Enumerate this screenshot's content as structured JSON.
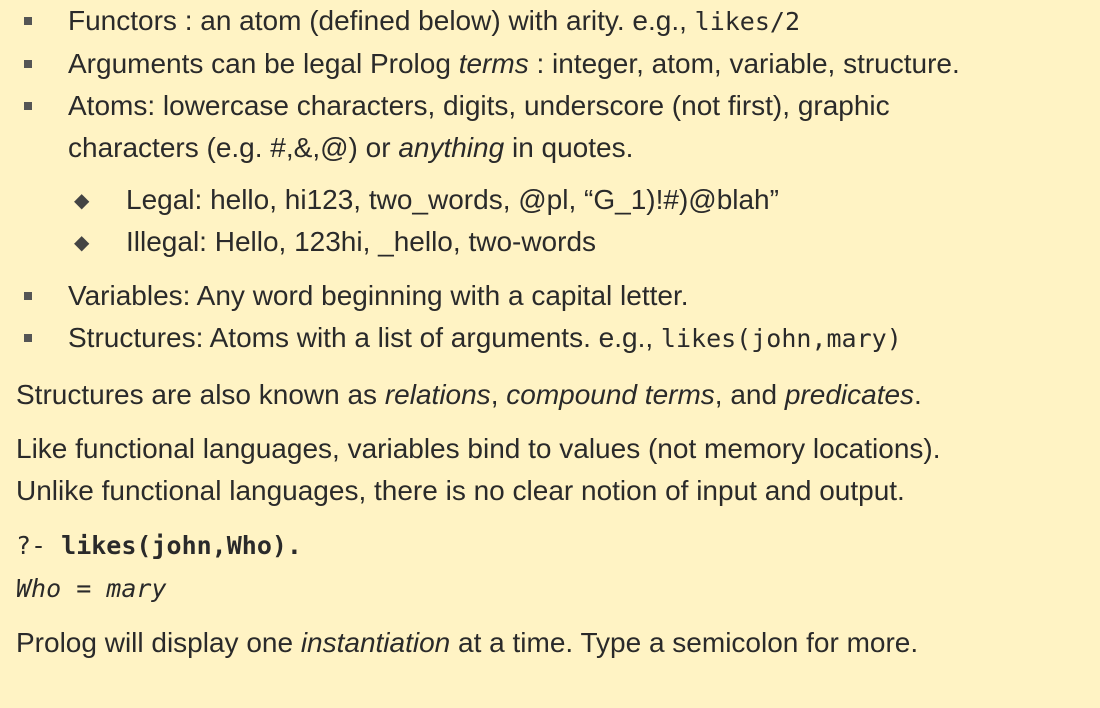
{
  "bullets": [
    {
      "pre": "Functors : an atom (defined below) with arity. e.g., ",
      "code": "likes/2"
    },
    {
      "pre": "Arguments can be legal Prolog ",
      "em": "terms",
      "post": " : integer, atom, variable, structure."
    },
    {
      "line1": "Atoms: lowercase characters, digits, underscore (not first), graphic",
      "line2_pre": "characters (e.g. #,&,@) or ",
      "em": "anything",
      "line2_post": " in quotes."
    },
    {
      "text": "Variables: Any word beginning with a capital letter."
    },
    {
      "pre": "Structures: Atoms with a list of arguments. e.g., ",
      "code": "likes(john,mary)"
    }
  ],
  "subbullets": [
    "Legal: hello, hi123, two_words, @pl, “G_1)!#)@blah”",
    "Illegal: Hello, 123hi, _hello, two-words"
  ],
  "para_structures": {
    "pre": "Structures are also known as ",
    "em1": "relations",
    "mid1": ", ",
    "em2": "compound terms",
    "mid2": ", and ",
    "em3": "predicates",
    "post": "."
  },
  "para_functional": {
    "line1": "Like functional languages, variables bind to values (not memory locations).",
    "line2": "Unlike functional languages, there is no clear notion of input and output."
  },
  "query": {
    "prompt": "?- ",
    "text": "likes(john,Who).",
    "result": "Who = mary"
  },
  "para_instantiation": {
    "pre": "Prolog will display one ",
    "em": "instantiation",
    "post": " at a time. Type a semicolon for more."
  }
}
